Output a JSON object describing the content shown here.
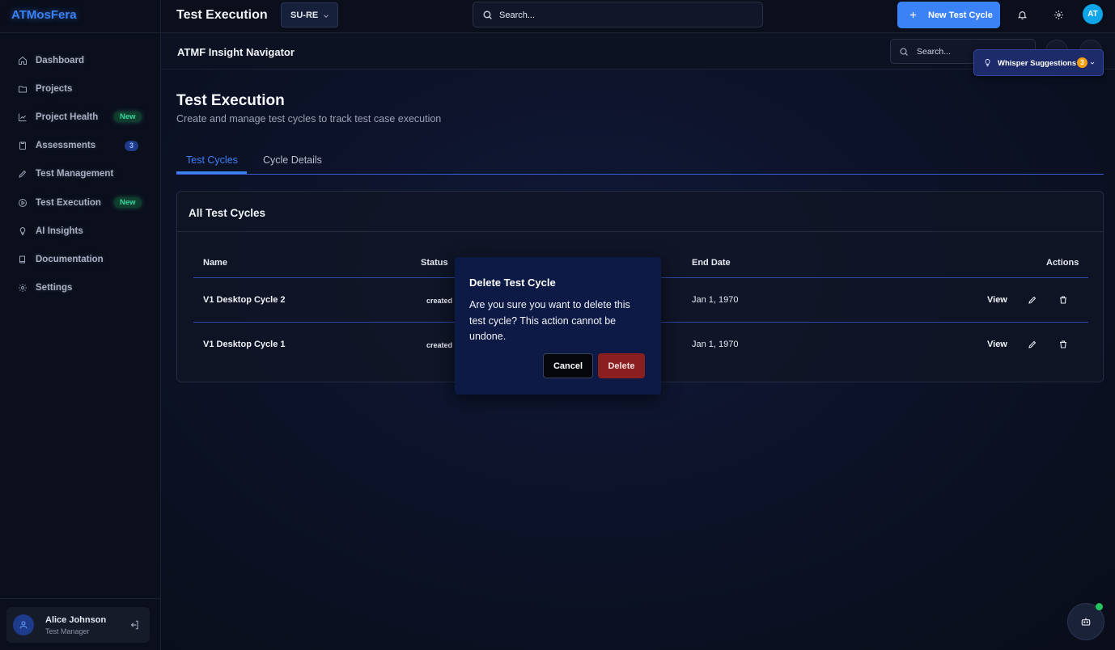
{
  "brand": "ATMosFera",
  "sidebar": {
    "items": [
      {
        "label": "Dashboard",
        "icon": "home-icon"
      },
      {
        "label": "Projects",
        "icon": "folder-icon"
      },
      {
        "label": "Project Health",
        "icon": "chart-line-icon",
        "badge": "New"
      },
      {
        "label": "Assessments",
        "icon": "clipboard-icon",
        "count": "3"
      },
      {
        "label": "Test Management",
        "icon": "pen-icon"
      },
      {
        "label": "Test Execution",
        "icon": "play-circle-icon",
        "badge": "New"
      },
      {
        "label": "AI Insights",
        "icon": "lightbulb-icon"
      },
      {
        "label": "Documentation",
        "icon": "book-icon"
      },
      {
        "label": "Settings",
        "icon": "gear-icon"
      }
    ]
  },
  "user": {
    "name": "Alice Johnson",
    "role": "Test Manager"
  },
  "header": {
    "title": "Test Execution",
    "project": "SU-RE",
    "search_placeholder": "Search...",
    "new_button": "New Test Cycle",
    "avatar": "AT"
  },
  "navigator": {
    "title": "ATMF Insight Navigator",
    "search_placeholder": "Search..."
  },
  "whisper": {
    "label": "Whisper Suggestions",
    "count": "3"
  },
  "page": {
    "title": "Test Execution",
    "subtitle": "Create and manage test cycles to track test case execution",
    "tabs": [
      "Test Cycles",
      "Cycle Details"
    ]
  },
  "table": {
    "title": "All Test Cycles",
    "columns": {
      "name": "Name",
      "status": "Status",
      "end_date": "End Date",
      "actions": "Actions"
    },
    "rows": [
      {
        "name": "V1 Desktop Cycle 2",
        "status": "created",
        "end_date": "Jan 1, 1970",
        "view": "View"
      },
      {
        "name": "V1 Desktop Cycle 1",
        "status": "created",
        "end_date": "Jan 1, 1970",
        "view": "View"
      }
    ]
  },
  "modal": {
    "title": "Delete Test Cycle",
    "body": "Are you sure you want to delete this test cycle? This action cannot be undone.",
    "cancel": "Cancel",
    "delete": "Delete"
  },
  "colors": {
    "accent": "#3b82f6",
    "danger": "#8b1e1e",
    "success": "#22c55e"
  }
}
